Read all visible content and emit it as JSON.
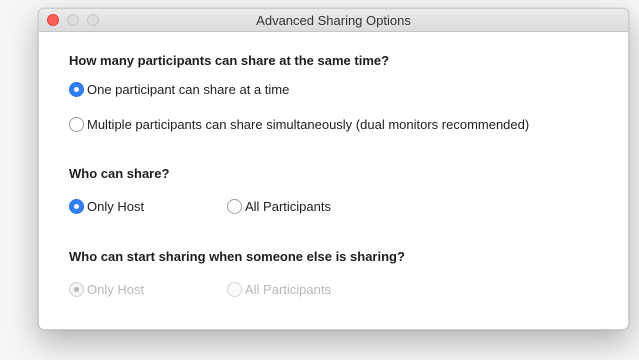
{
  "window": {
    "title": "Advanced Sharing Options"
  },
  "sections": [
    {
      "question": "How many participants can share at the same time?",
      "options": [
        {
          "label": "One participant can share at a time",
          "selected": true
        },
        {
          "label": "Multiple participants can share simultaneously (dual monitors recommended)",
          "selected": false
        }
      ]
    },
    {
      "question": "Who can share?",
      "options": [
        {
          "label": "Only Host",
          "selected": true
        },
        {
          "label": "All Participants",
          "selected": false
        }
      ]
    },
    {
      "question": "Who can start sharing when someone else is sharing?",
      "disabled": true,
      "options": [
        {
          "label": "Only Host",
          "selected": true
        },
        {
          "label": "All Participants",
          "selected": false
        }
      ]
    }
  ]
}
